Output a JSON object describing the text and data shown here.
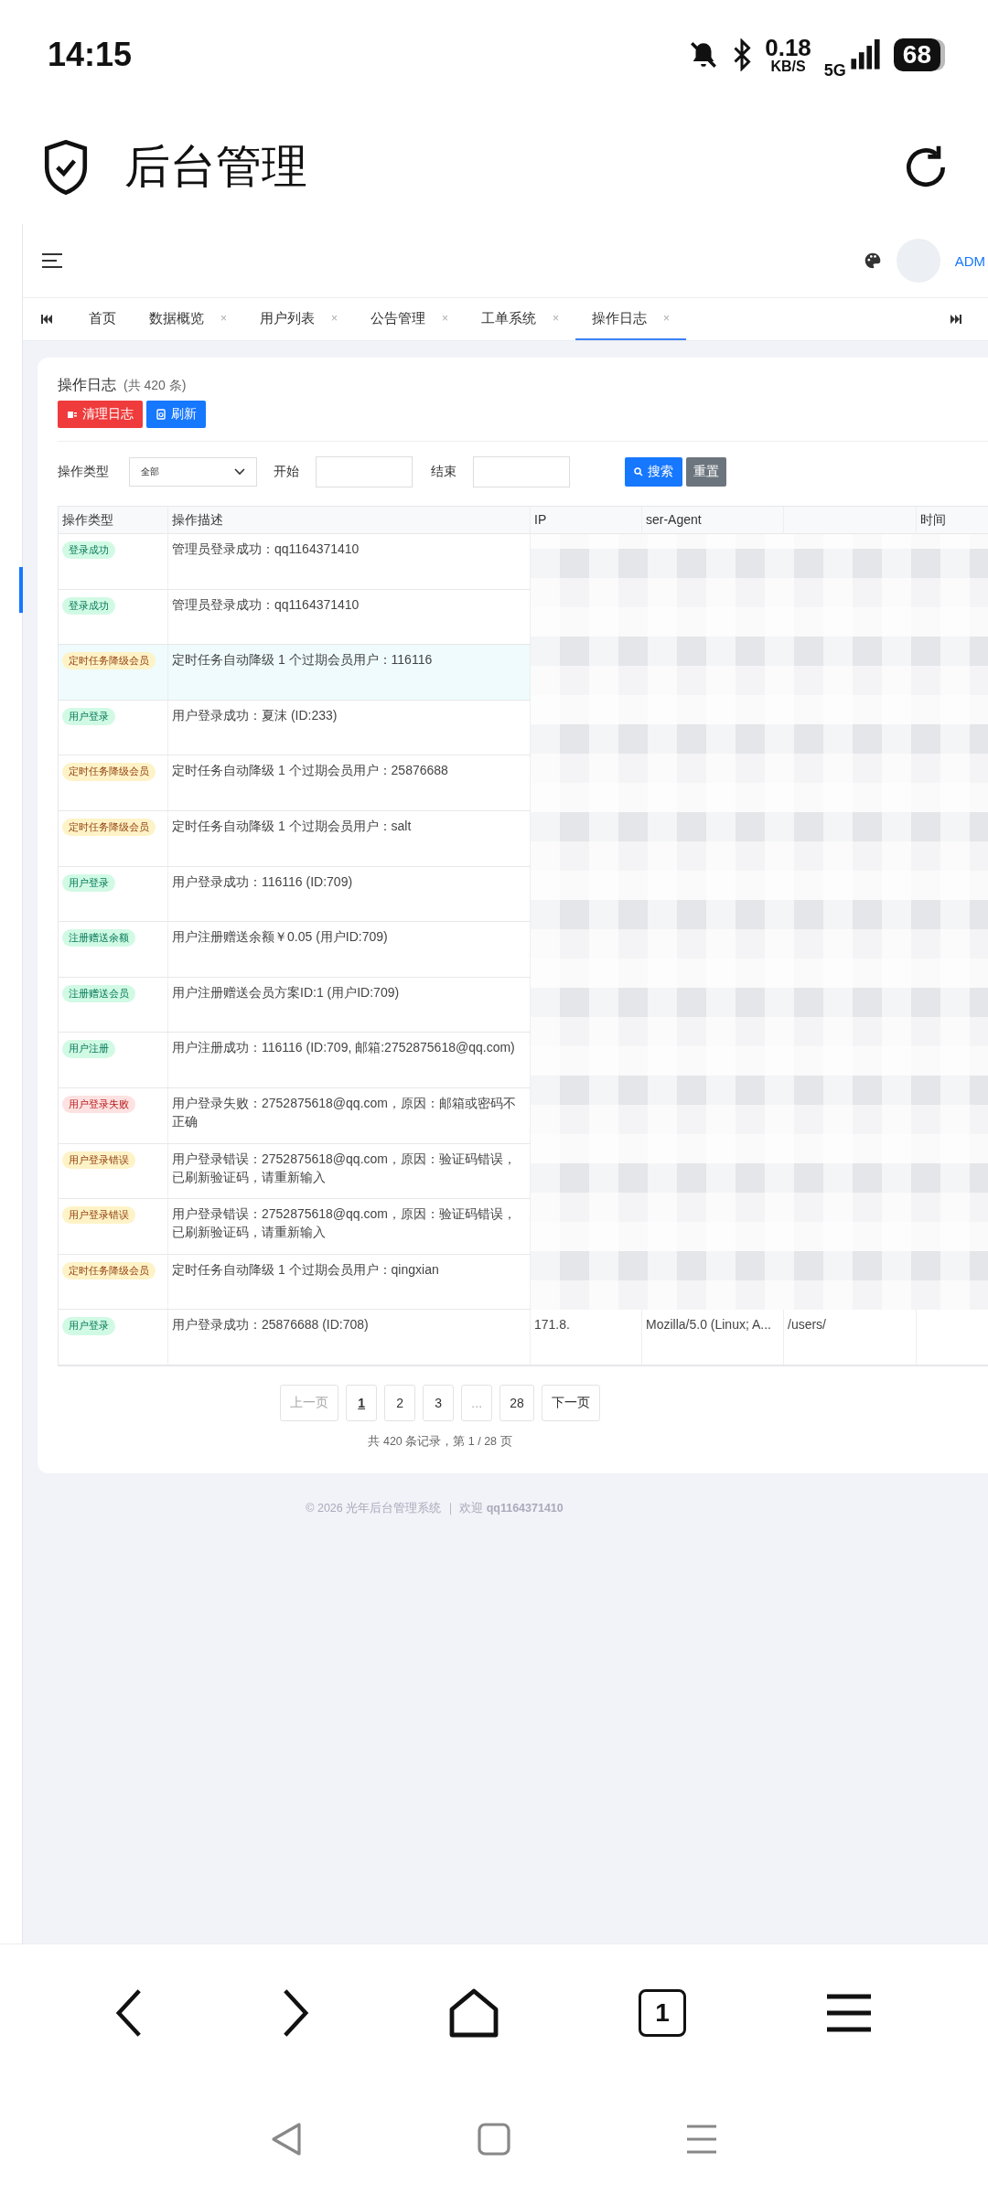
{
  "status_bar": {
    "time": "14:15",
    "net_speed": "0.18",
    "net_unit": "KB/S",
    "network": "5G",
    "battery": "68"
  },
  "app_bar": {
    "title": "后台管理"
  },
  "header": {
    "user": "ADM"
  },
  "tabs": [
    {
      "label": "首页",
      "selected": false
    },
    {
      "label": "数据概览",
      "close": "×",
      "selected": false
    },
    {
      "label": "用户列表",
      "close": "×",
      "selected": false
    },
    {
      "label": "公告管理",
      "close": "×",
      "selected": false
    },
    {
      "label": "工单系统",
      "close": "×",
      "selected": false
    },
    {
      "label": "操作日志",
      "close": "×",
      "selected": true
    }
  ],
  "card": {
    "title": "操作日志",
    "count": "(共 420 条)",
    "buttons": [
      {
        "label": "清理日志",
        "kind": "danger"
      },
      {
        "label": "刷新",
        "kind": "primary"
      }
    ]
  },
  "filters": {
    "type_label": "操作类型",
    "type_value": "全部",
    "start_label": "开始",
    "end_label": "结束",
    "search": "搜索",
    "reset": "重置"
  },
  "table": {
    "columns": [
      {
        "label": "操作类型"
      },
      {
        "label": "操作描述"
      },
      {
        "label": "IP"
      },
      {
        "label": "ser-Agent"
      },
      {
        "label": "时间"
      }
    ],
    "rows": [
      {
        "type": "登录成功",
        "color": "#d1fae5",
        "desc": "管理员登录成功：qq1164371410",
        "highlighted": false
      },
      {
        "type": "登录成功",
        "color": "#d1fae5",
        "desc": "管理员登录成功：qq1164371410",
        "highlighted": false
      },
      {
        "type": "定时任务降级会员",
        "color": "#fef3c7",
        "desc": "定时任务自动降级 1 个过期会员用户：116116",
        "highlighted": true
      },
      {
        "type": "用户登录",
        "color": "#d1fae5",
        "desc": "用户登录成功：夏沫 (ID:233)",
        "highlighted": false
      },
      {
        "type": "定时任务降级会员",
        "color": "#fef3c7",
        "desc": "定时任务自动降级 1 个过期会员用户：25876688",
        "highlighted": false
      },
      {
        "type": "定时任务降级会员",
        "color": "#fef3c7",
        "desc": "定时任务自动降级 1 个过期会员用户：salt",
        "highlighted": false
      },
      {
        "type": "用户登录",
        "color": "#d1fae5",
        "desc": "用户登录成功：116116 (ID:709)",
        "highlighted": false
      },
      {
        "type": "注册赠送余额",
        "color": "#d1fae5",
        "desc": "用户注册赠送余额￥0.05 (用户ID:709)",
        "highlighted": false
      },
      {
        "type": "注册赠送会员",
        "color": "#d1fae5",
        "desc": "用户注册赠送会员方案ID:1 (用户ID:709)",
        "highlighted": false
      },
      {
        "type": "用户注册",
        "color": "#d1fae5",
        "desc": "用户注册成功：116116 (ID:709, 邮箱:2752875618@qq.com)",
        "highlighted": false
      },
      {
        "type": "用户登录失败",
        "color": "#fee2e2",
        "desc": "用户登录失败：2752875618@qq.com，原因：邮箱或密码不正确",
        "highlighted": false
      },
      {
        "type": "用户登录错误",
        "color": "#fef3c7",
        "desc": "用户登录错误：2752875618@qq.com，原因：验证码错误，已刷新验证码，请重新输入",
        "highlighted": false
      },
      {
        "type": "用户登录错误",
        "color": "#fef3c7",
        "desc": "用户登录错误：2752875618@qq.com，原因：验证码错误，已刷新验证码，请重新输入",
        "highlighted": false
      },
      {
        "type": "定时任务降级会员",
        "color": "#fef3c7",
        "desc": "定时任务自动降级 1 个过期会员用户：qingxian",
        "highlighted": false
      },
      {
        "type": "用户登录",
        "color": "#d1fae5",
        "desc": "用户登录成功：25876688 (ID:708)",
        "highlighted": false,
        "ip": "171.8.",
        "ua": "Mozilla/5.0 (Linux; A...",
        "path": "/users/"
      }
    ]
  },
  "pagination": {
    "prev": {
      "label": "上一页",
      "disabled": true
    },
    "pages": [
      {
        "label": "1",
        "selected": true,
        "disabled": false
      },
      {
        "label": "2",
        "selected": false,
        "disabled": false
      },
      {
        "label": "3",
        "selected": false,
        "disabled": false
      },
      {
        "label": "...",
        "selected": false,
        "disabled": true
      },
      {
        "label": "28",
        "selected": false,
        "disabled": false
      }
    ],
    "next": {
      "label": "下一页",
      "disabled": false
    },
    "summary": "共 420 条记录，第 1 / 28 页"
  },
  "footer": "© 2026 光年后台管理系统 ｜ 欢迎 **qq1164371410**",
  "browser_bar": {
    "tab_count": "1"
  }
}
